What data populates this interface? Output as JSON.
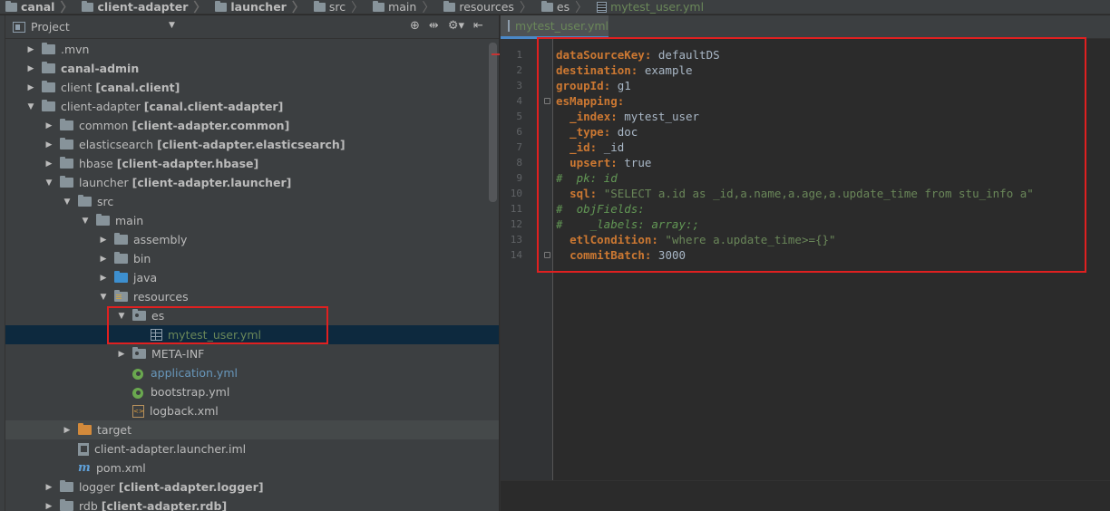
{
  "breadcrumb": [
    {
      "label": "canal",
      "bold": true,
      "icon": "folder-icon"
    },
    {
      "label": "client-adapter",
      "bold": true,
      "icon": "folder-icon"
    },
    {
      "label": "launcher",
      "bold": true,
      "icon": "folder-icon"
    },
    {
      "label": "src",
      "bold": false,
      "icon": "folder-icon"
    },
    {
      "label": "main",
      "bold": false,
      "icon": "folder-icon"
    },
    {
      "label": "resources",
      "bold": false,
      "icon": "folder-icon"
    },
    {
      "label": "es",
      "bold": false,
      "icon": "folder-icon"
    },
    {
      "label": "mytest_user.yml",
      "bold": false,
      "icon": "yml-file-icon"
    }
  ],
  "project_panel": {
    "title": "Project",
    "tools": [
      "⊕",
      "⇹",
      "⚙▾",
      "⇤"
    ]
  },
  "tree": [
    {
      "label": ".mvn",
      "module": "",
      "depth": 0,
      "arrow": "▶",
      "icon": "folder",
      "bold": false
    },
    {
      "label": "canal-admin",
      "module": "",
      "depth": 0,
      "arrow": "▶",
      "icon": "folder",
      "bold": true
    },
    {
      "label": "client",
      "module": "[canal.client]",
      "depth": 0,
      "arrow": "▶",
      "icon": "folder",
      "bold": false
    },
    {
      "label": "client-adapter",
      "module": "[canal.client-adapter]",
      "depth": 0,
      "arrow": "▼",
      "icon": "folder",
      "bold": false
    },
    {
      "label": "common",
      "module": "[client-adapter.common]",
      "depth": 1,
      "arrow": "▶",
      "icon": "folder",
      "bold": false
    },
    {
      "label": "elasticsearch",
      "module": "[client-adapter.elasticsearch]",
      "depth": 1,
      "arrow": "▶",
      "icon": "folder",
      "bold": false
    },
    {
      "label": "hbase",
      "module": "[client-adapter.hbase]",
      "depth": 1,
      "arrow": "▶",
      "icon": "folder",
      "bold": false
    },
    {
      "label": "launcher",
      "module": "[client-adapter.launcher]",
      "depth": 1,
      "arrow": "▼",
      "icon": "folder",
      "bold": false
    },
    {
      "label": "src",
      "module": "",
      "depth": 2,
      "arrow": "▼",
      "icon": "folder",
      "bold": false
    },
    {
      "label": "main",
      "module": "",
      "depth": 3,
      "arrow": "▼",
      "icon": "folder",
      "bold": false
    },
    {
      "label": "assembly",
      "module": "",
      "depth": 4,
      "arrow": "▶",
      "icon": "folder",
      "bold": false
    },
    {
      "label": "bin",
      "module": "",
      "depth": 4,
      "arrow": "▶",
      "icon": "folder",
      "bold": false
    },
    {
      "label": "java",
      "module": "",
      "depth": 4,
      "arrow": "▶",
      "icon": "folder-blue",
      "bold": false
    },
    {
      "label": "resources",
      "module": "",
      "depth": 4,
      "arrow": "▼",
      "icon": "folder-res",
      "bold": false
    },
    {
      "label": "es",
      "module": "",
      "depth": 5,
      "arrow": "▼",
      "icon": "folder-pkg",
      "bold": false
    },
    {
      "label": "mytest_user.yml",
      "module": "",
      "depth": 6,
      "arrow": "",
      "icon": "yml",
      "bold": false,
      "selected": true
    },
    {
      "label": "META-INF",
      "module": "",
      "depth": 5,
      "arrow": "▶",
      "icon": "folder-pkg",
      "bold": false
    },
    {
      "label": "application.yml",
      "module": "",
      "depth": 5,
      "arrow": "",
      "icon": "spring",
      "bold": false,
      "blue": true
    },
    {
      "label": "bootstrap.yml",
      "module": "",
      "depth": 5,
      "arrow": "",
      "icon": "spring",
      "bold": false
    },
    {
      "label": "logback.xml",
      "module": "",
      "depth": 5,
      "arrow": "",
      "icon": "xml",
      "bold": false
    },
    {
      "label": "target",
      "module": "",
      "depth": 2,
      "arrow": "▶",
      "icon": "folder-orange",
      "bold": false,
      "hover": true
    },
    {
      "label": "client-adapter.launcher.iml",
      "module": "",
      "depth": 2,
      "arrow": "",
      "icon": "iml",
      "bold": false
    },
    {
      "label": "pom.xml",
      "module": "",
      "depth": 2,
      "arrow": "",
      "icon": "maven",
      "bold": false
    },
    {
      "label": "logger",
      "module": "[client-adapter.logger]",
      "depth": 1,
      "arrow": "▶",
      "icon": "folder",
      "bold": false
    },
    {
      "label": "rdb",
      "module": "[client-adapter.rdb]",
      "depth": 1,
      "arrow": "▶",
      "icon": "folder",
      "bold": false
    }
  ],
  "editor": {
    "tab_label": "mytest_user.yml",
    "line_numbers": [
      "1",
      "2",
      "3",
      "4",
      "5",
      "6",
      "7",
      "8",
      "9",
      "10",
      "11",
      "12",
      "13",
      "14"
    ],
    "lines": [
      [
        {
          "t": "k",
          "v": "dataSourceKey"
        },
        {
          "t": "k",
          "v": ":"
        },
        {
          "t": "v",
          "v": " defaultDS"
        }
      ],
      [
        {
          "t": "k",
          "v": "destination"
        },
        {
          "t": "k",
          "v": ":"
        },
        {
          "t": "v",
          "v": " example"
        }
      ],
      [
        {
          "t": "k",
          "v": "groupId"
        },
        {
          "t": "k",
          "v": ":"
        },
        {
          "t": "v",
          "v": " g1"
        }
      ],
      [
        {
          "t": "k",
          "v": "esMapping"
        },
        {
          "t": "k",
          "v": ":"
        }
      ],
      [
        {
          "t": "v",
          "v": "  "
        },
        {
          "t": "k",
          "v": "_index"
        },
        {
          "t": "k",
          "v": ":"
        },
        {
          "t": "v",
          "v": " mytest_user"
        }
      ],
      [
        {
          "t": "v",
          "v": "  "
        },
        {
          "t": "k",
          "v": "_type"
        },
        {
          "t": "k",
          "v": ":"
        },
        {
          "t": "v",
          "v": " doc"
        }
      ],
      [
        {
          "t": "v",
          "v": "  "
        },
        {
          "t": "k",
          "v": "_id"
        },
        {
          "t": "k",
          "v": ":"
        },
        {
          "t": "v",
          "v": " _id"
        }
      ],
      [
        {
          "t": "v",
          "v": "  "
        },
        {
          "t": "k",
          "v": "upsert"
        },
        {
          "t": "k",
          "v": ":"
        },
        {
          "t": "v",
          "v": " true"
        }
      ],
      [
        {
          "t": "c",
          "v": "#  pk: id"
        }
      ],
      [
        {
          "t": "v",
          "v": "  "
        },
        {
          "t": "k",
          "v": "sql"
        },
        {
          "t": "k",
          "v": ":"
        },
        {
          "t": "s",
          "v": " \"SELECT a.id as _id,a.name,a.age,a.update_time from stu_info a\""
        }
      ],
      [
        {
          "t": "c",
          "v": "#  objFields:"
        }
      ],
      [
        {
          "t": "c",
          "v": "#    _labels: array:;"
        }
      ],
      [
        {
          "t": "v",
          "v": "  "
        },
        {
          "t": "k",
          "v": "etlCondition"
        },
        {
          "t": "k",
          "v": ":"
        },
        {
          "t": "s",
          "v": " \"where a.update_time>={}\""
        }
      ],
      [
        {
          "t": "v",
          "v": "  "
        },
        {
          "t": "k",
          "v": "commitBatch"
        },
        {
          "t": "k",
          "v": ":"
        },
        {
          "t": "v",
          "v": " 3000"
        }
      ]
    ]
  }
}
